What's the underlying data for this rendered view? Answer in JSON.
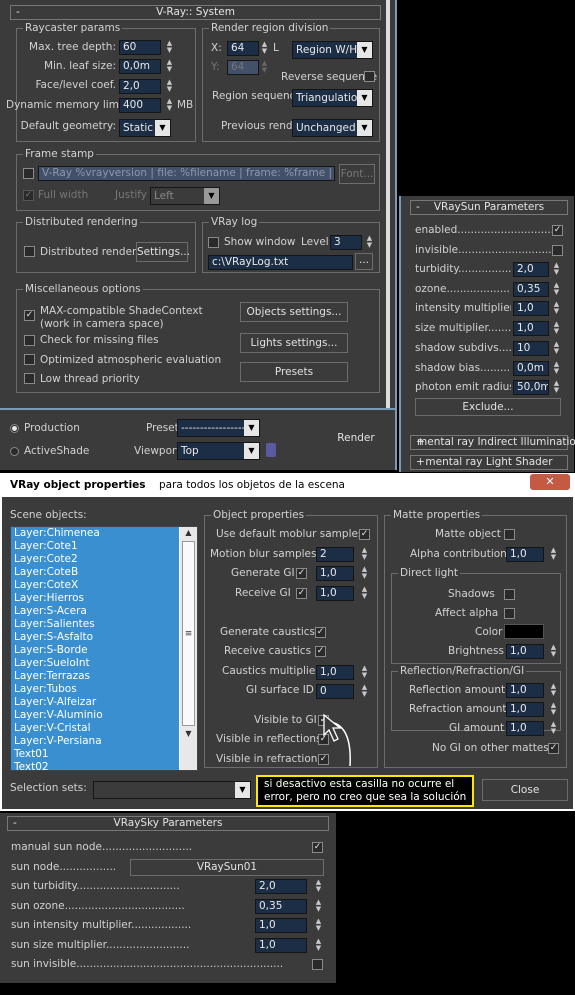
{
  "system": {
    "title": "V-Ray:: System",
    "raycaster": {
      "title": "Raycaster params",
      "max_tree_depth": {
        "label": "Max. tree depth:",
        "value": "60"
      },
      "min_leaf_size": {
        "label": "Min. leaf size:",
        "value": "0,0m"
      },
      "face_level_coef": {
        "label": "Face/level coef.",
        "value": "2,0"
      },
      "dyn_mem_limit": {
        "label": "Dynamic memory limit:",
        "value": "400",
        "unit": "MB"
      },
      "default_geometry": {
        "label": "Default geometry:",
        "value": "Static"
      }
    },
    "render_region": {
      "title": "Render region division",
      "x_label": "X:",
      "x_value": "64",
      "l_label": "L",
      "y_label": "Y:",
      "y_value": "64",
      "mode": "Region W/H",
      "reverse_label": "Reverse sequence",
      "sequence_label": "Region sequence:",
      "sequence_value": "Triangulation",
      "previous_label": "Previous render:",
      "previous_value": "Unchanged"
    },
    "frame_stamp": {
      "title": "Frame stamp",
      "text": "V-Ray %vrayversion | file: %filename | frame: %frame | primitives: %primiti",
      "font_button": "Font...",
      "full_width": "Full width",
      "justify_label": "Justify",
      "justify_value": "Left"
    },
    "distributed": {
      "title": "Distributed rendering",
      "checkbox_label": "Distributed rendering",
      "settings_button": "Settings..."
    },
    "vray_log": {
      "title": "VRay log",
      "show_window": "Show window",
      "level_label": "Level:",
      "level_value": "3",
      "path": "c:\\VRayLog.txt",
      "browse": "..."
    },
    "misc": {
      "title": "Miscellaneous options",
      "max_compat_1": "MAX-compatible ShadeContext",
      "max_compat_2": "(work in camera space)",
      "check_missing": "Check for missing files",
      "optimized_atmo": "Optimized atmospheric evaluation",
      "low_thread": "Low thread priority",
      "objects_settings": "Objects settings...",
      "lights_settings": "Lights settings...",
      "presets": "Presets"
    }
  },
  "render_bar": {
    "production": "Production",
    "activeshade": "ActiveShade",
    "preset_label": "Preset:",
    "preset_value": "-----------------",
    "viewport_label": "Viewport:",
    "viewport_value": "Top",
    "render_button": "Render"
  },
  "vraysun": {
    "title": "VRaySun Parameters",
    "collapse": "-",
    "enabled": "enabled................................",
    "invisible": "invisible...............................",
    "turbidity": {
      "label": "turbidity...................",
      "value": "2,0"
    },
    "ozone": {
      "label": "ozone.........................",
      "value": "0,35"
    },
    "intensity": {
      "label": "intensity multiplier......",
      "value": "1,0"
    },
    "size": {
      "label": "size multiplier...........",
      "value": "1,0"
    },
    "shadow_subdivs": {
      "label": "shadow subdivs..........",
      "value": "10"
    },
    "shadow_bias": {
      "label": "shadow bias...............",
      "value": "0,0m"
    },
    "photon_radius": {
      "label": "photon emit radius.....",
      "value": "50,0m"
    },
    "exclude_button": "Exclude...",
    "rollout_gi": "mental ray Indirect Illumination",
    "rollout_gi_sign": "+",
    "rollout_shader": "mental ray Light Shader",
    "rollout_shader_sign": "+"
  },
  "objprops": {
    "title": "VRay object properties",
    "subtitle": "para todos los objetos de la escena",
    "close": "✕",
    "scene_objects_label": "Scene objects:",
    "scene_objects": [
      "Layer:Chimenea",
      "Layer:Cote1",
      "Layer:Cote2",
      "Layer:CoteB",
      "Layer:CoteX",
      "Layer:Hierros",
      "Layer:S-Acera",
      "Layer:Salientes",
      "Layer:S-Asfalto",
      "Layer:S-Borde",
      "Layer:SueloInt",
      "Layer:Terrazas",
      "Layer:Tubos",
      "Layer:V-Alfeizar",
      "Layer:V-Aluminio",
      "Layer:V-Cristal",
      "Layer:V-Persiana",
      "Text01",
      "Text02"
    ],
    "object_props": {
      "title": "Object properties",
      "use_default_moblur": "Use default moblur samples",
      "motion_blur": {
        "label": "Motion blur samples",
        "value": "2"
      },
      "generate_gi": {
        "label": "Generate GI",
        "value": "1,0"
      },
      "receive_gi": {
        "label": "Receive GI",
        "value": "1,0"
      },
      "generate_caustics": "Generate caustics",
      "receive_caustics": "Receive caustics",
      "caustics_mult": {
        "label": "Caustics multiplier",
        "value": "1,0"
      },
      "gi_surface_id": {
        "label": "GI surface ID",
        "value": "0"
      },
      "visible_gi": "Visible to GI",
      "visible_reflections": "Visible in reflections",
      "visible_refractions": "Visible in refractions"
    },
    "matte": {
      "title": "Matte properties",
      "matte_object": "Matte object",
      "alpha_contrib": {
        "label": "Alpha contribution",
        "value": "1,0"
      },
      "direct_light": "Direct light",
      "shadows": "Shadows",
      "affect_alpha": "Affect alpha",
      "color": "Color",
      "color_value": "#000000",
      "brightness": {
        "label": "Brightness",
        "value": "1,0"
      },
      "rrgi": "Reflection/Refraction/GI",
      "reflection_amount": {
        "label": "Reflection amount",
        "value": "1,0"
      },
      "refraction_amount": {
        "label": "Refraction amount",
        "value": "1,0"
      },
      "gi_amount": {
        "label": "GI amount",
        "value": "1,0"
      },
      "no_gi_other": "No GI on other mattes"
    },
    "selection_sets_label": "Selection sets:",
    "note_line1": "si desactivo esta casilla no ocurre el",
    "note_line2": "error, pero no creo que sea la solución",
    "close_button": "Close"
  },
  "vraysky": {
    "title": "VRaySky Parameters",
    "collapse": "-",
    "manual_sun": "manual sun node...........................",
    "sun_node_label": "sun node.................",
    "sun_node_value": "VRaySun01",
    "turbidity": {
      "label": "sun turbidity...............................",
      "value": "2,0"
    },
    "ozone": {
      "label": "sun ozone....................................",
      "value": "0,35"
    },
    "intensity": {
      "label": "sun intensity multiplier..................",
      "value": "1,0"
    },
    "size": {
      "label": "sun size multiplier.........................",
      "value": "1,0"
    },
    "invisible": "sun invisible.............................................................."
  }
}
